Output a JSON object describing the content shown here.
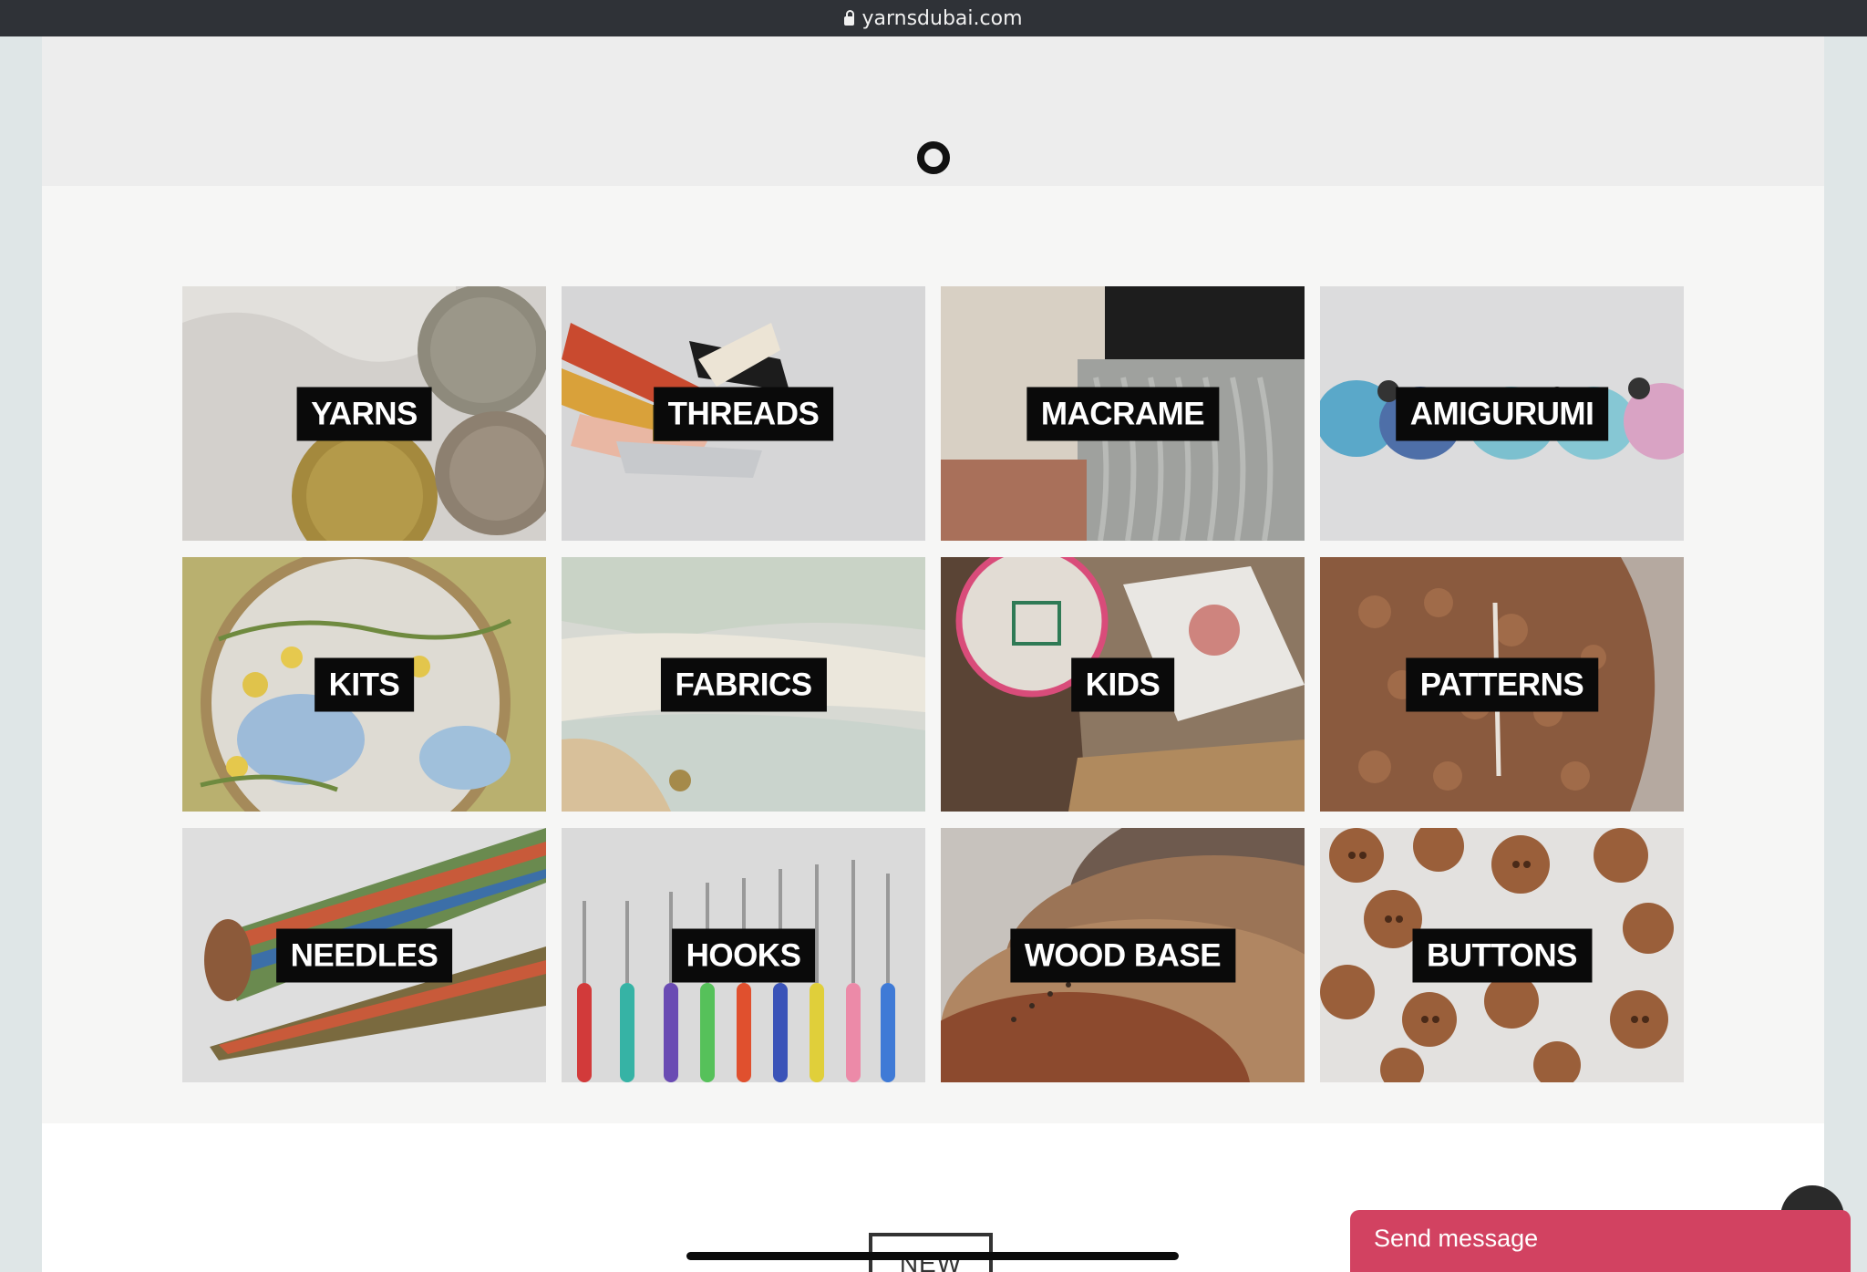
{
  "browser": {
    "url": "yarnsdubai.com",
    "lock_icon": "lock-icon"
  },
  "loader": {
    "icon": "loading-spinner-icon"
  },
  "categories": [
    {
      "label": "YARNS",
      "bg": "#cfcac2"
    },
    {
      "label": "THREADS",
      "bg": "#d4d3d3"
    },
    {
      "label": "MACRAME",
      "bg": "#a9a7a1"
    },
    {
      "label": "AMIGURUMI",
      "bg": "#dcdbdc"
    },
    {
      "label": "KITS",
      "bg": "#d5d0c2"
    },
    {
      "label": "FABRICS",
      "bg": "#d8d7ce"
    },
    {
      "label": "KIDS",
      "bg": "#8f7b66"
    },
    {
      "label": "PATTERNS",
      "bg": "#9a6d52"
    },
    {
      "label": "NEEDLES",
      "bg": "#dadada"
    },
    {
      "label": "HOOKS",
      "bg": "#d9d9d9"
    },
    {
      "label": "WOOD BASE",
      "bg": "#b7afa7"
    },
    {
      "label": "BUTTONS",
      "bg": "#d2cfcd"
    }
  ],
  "section": {
    "new_label": "NEW"
  },
  "chat": {
    "send_message_label": "Send message",
    "accent_color": "#d24261"
  },
  "scroll_top": {
    "icon": "arrow-up-icon"
  }
}
